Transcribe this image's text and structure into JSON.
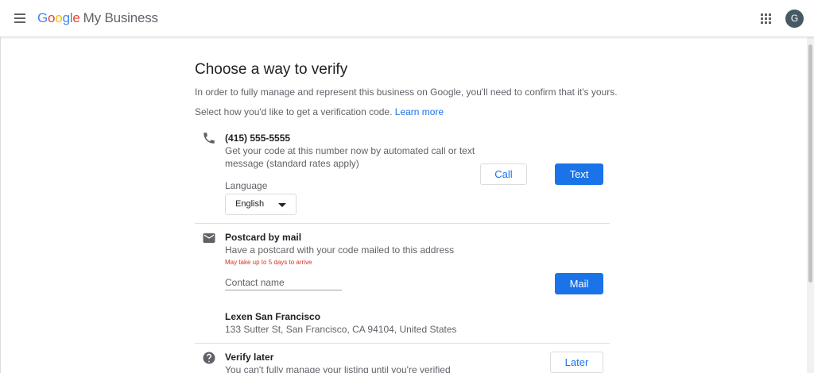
{
  "header": {
    "logo_letters": [
      "G",
      "o",
      "o",
      "g",
      "l",
      "e"
    ],
    "product_name": "My Business",
    "avatar_initial": "G"
  },
  "page": {
    "title": "Choose a way to verify",
    "intro": "In order to fully manage and represent this business on Google, you'll need to confirm that it's yours.",
    "select_prompt": "Select how you'd like to get a verification code.",
    "learn_more": "Learn more"
  },
  "phone_option": {
    "icon": "phone-icon",
    "number": "(415) 555-5555",
    "description_line1": "Get your code at this number now by automated call or text",
    "description_line2": "message (standard rates apply)",
    "language_label": "Language",
    "language_value": "English",
    "call_label": "Call",
    "text_label": "Text"
  },
  "mail_option": {
    "icon": "mail-icon",
    "title": "Postcard by mail",
    "description": "Have a postcard with your code mailed to this address",
    "warning": "May take up to 5 days to arrive",
    "contact_placeholder": "Contact name",
    "contact_value": "",
    "mail_label": "Mail",
    "business_name": "Lexen San Francisco",
    "business_address": "133 Sutter St, San Francisco, CA 94104, United States"
  },
  "later_option": {
    "icon": "help-icon",
    "title": "Verify later",
    "description": "You can't fully manage your listing until you're verified",
    "later_label": "Later"
  },
  "colors": {
    "primary": "#1a73e8",
    "warning": "#d93025",
    "text_secondary": "#5f6368"
  }
}
